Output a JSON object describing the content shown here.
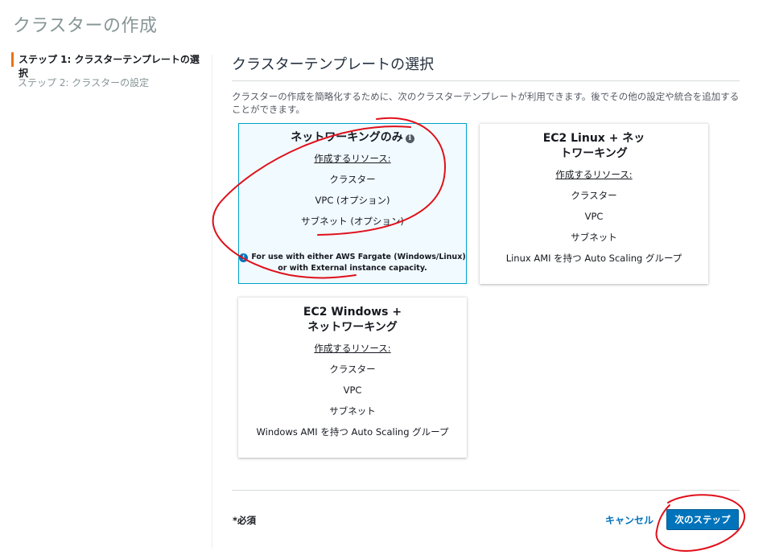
{
  "page": {
    "title": "クラスターの作成"
  },
  "steps": [
    {
      "label": "ステップ 1: クラスターテンプレートの選択",
      "active": true
    },
    {
      "label": "ステップ 2: クラスターの設定",
      "active": false
    }
  ],
  "section": {
    "title": "クラスターテンプレートの選択",
    "description": "クラスターの作成を簡略化するために、次のクラスターテンプレートが利用できます。後でその他の設定や統合を追加することができます。"
  },
  "cards": [
    {
      "title": "ネットワーキングのみ",
      "info_icon": "info-icon",
      "resources_label": "作成するリソース:",
      "resources": [
        "クラスター",
        "VPC (オプション)",
        "サブネット (オプション)"
      ],
      "note_line1": "For use with either AWS Fargate (Windows/Linux)",
      "note_line2": "or with External instance capacity.",
      "selected": true
    },
    {
      "title_line1": "EC2 Linux + ネッ",
      "title_line2": "トワーキング",
      "resources_label": "作成するリソース:",
      "resources": [
        "クラスター",
        "VPC",
        "サブネット",
        "Linux AMI を持つ Auto Scaling グループ"
      ]
    },
    {
      "title_line1": "EC2 Windows +",
      "title_line2": "ネットワーキング",
      "resources_label": "作成するリソース:",
      "resources": [
        "クラスター",
        "VPC",
        "サブネット",
        "Windows AMI を持つ Auto Scaling グループ"
      ]
    }
  ],
  "footer": {
    "required_label": "*必須",
    "cancel_label": "キャンセル",
    "next_label": "次のステップ"
  },
  "colors": {
    "primary": "#0073bb",
    "accent": "#ec7211",
    "annotation": "#e0101a"
  }
}
